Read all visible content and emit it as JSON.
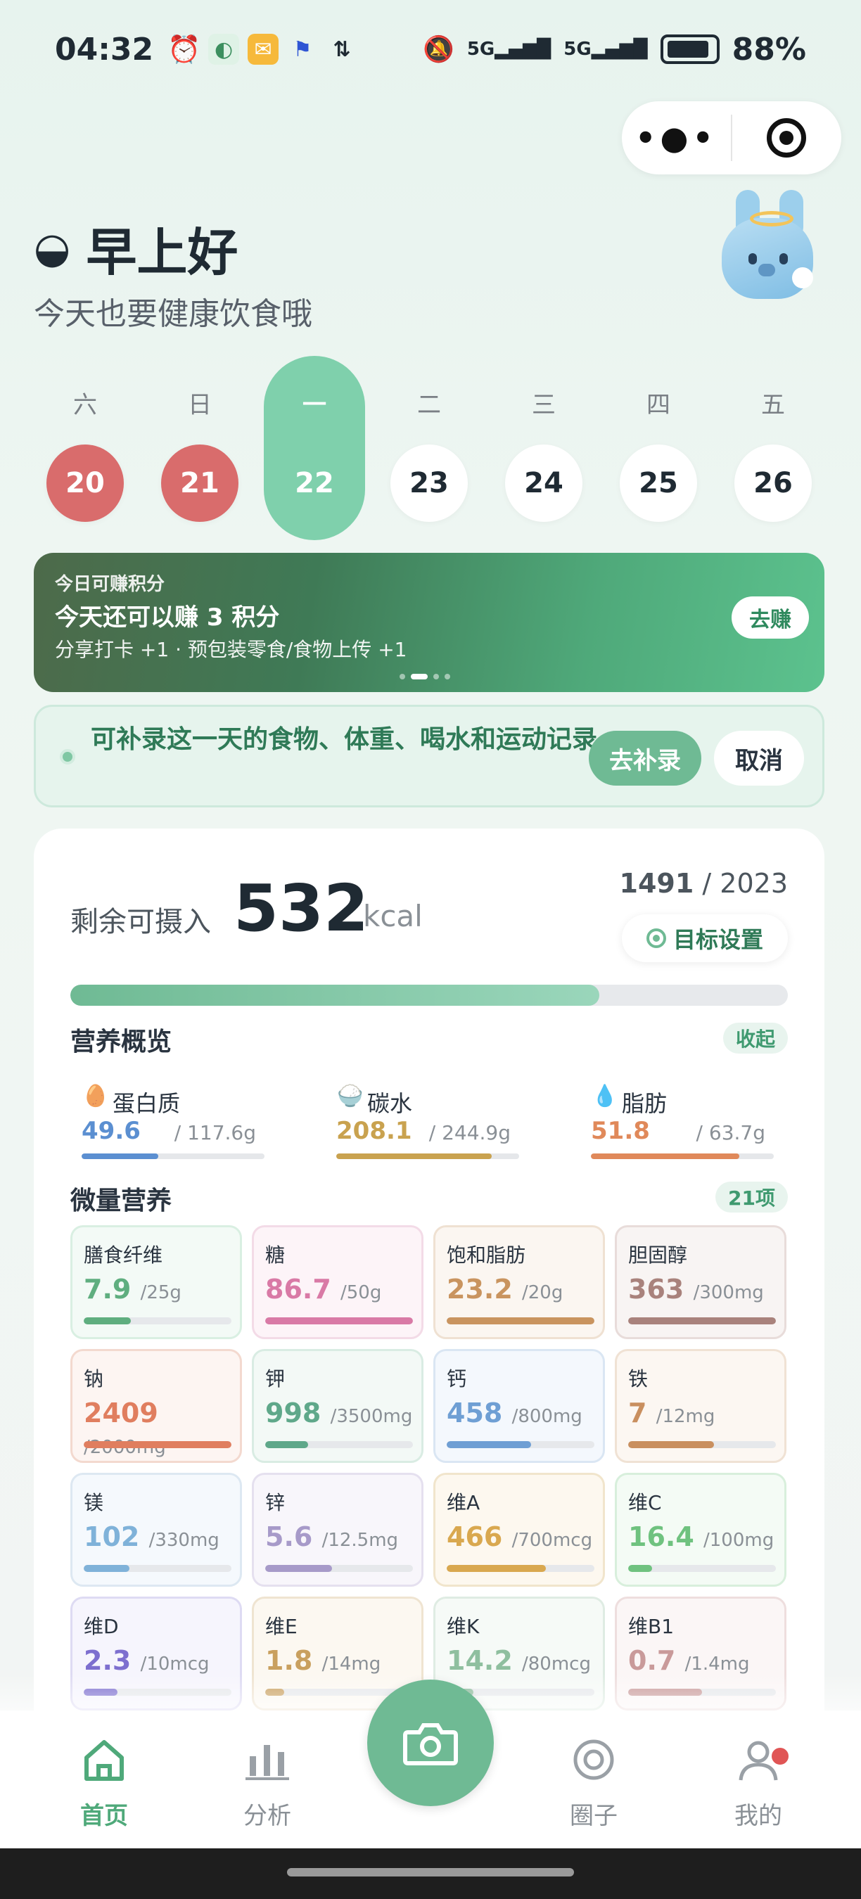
{
  "status": {
    "time": "04:32",
    "battery": "88%",
    "net1": "5G",
    "net2": "5G"
  },
  "greeting": {
    "title": "早上好",
    "subtitle": "今天也要健康饮食哦"
  },
  "week": [
    {
      "wd": "六",
      "num": "20",
      "state": "red"
    },
    {
      "wd": "日",
      "num": "21",
      "state": "red"
    },
    {
      "wd": "一",
      "num": "22",
      "state": "selected"
    },
    {
      "wd": "二",
      "num": "23",
      "state": "normal"
    },
    {
      "wd": "三",
      "num": "24",
      "state": "normal"
    },
    {
      "wd": "四",
      "num": "25",
      "state": "normal"
    },
    {
      "wd": "五",
      "num": "26",
      "state": "normal"
    }
  ],
  "banner": {
    "label": "今日可赚积分",
    "title": "今天还可以赚 3 积分",
    "desc": "分享打卡 +1 · 预包装零食/食物上传 +1",
    "button": "去赚"
  },
  "notice": {
    "text": "可补录这一天的食物、体重、喝水和运动记录",
    "primary": "去补录",
    "secondary": "取消"
  },
  "calories": {
    "label": "剩余可摄入",
    "value": "532",
    "unit": "kcal",
    "eaten": "1491",
    "target": "/ 2023",
    "goal_button": "目标设置",
    "progress": 0.737
  },
  "nutrition": {
    "title": "营养概览",
    "toggle": "收起"
  },
  "macros": [
    {
      "name": "蛋白质",
      "icon": "egg-icon",
      "value": "49.6",
      "total": "/ 117.6g",
      "pct": 0.42,
      "color": "#5b8fd1"
    },
    {
      "name": "碳水",
      "icon": "rice-bowl-icon",
      "value": "208.1",
      "total": "/ 244.9g",
      "pct": 0.85,
      "color": "#c9a24f"
    },
    {
      "name": "脂肪",
      "icon": "oil-drop-icon",
      "value": "51.8",
      "total": "/ 63.7g",
      "pct": 0.81,
      "color": "#e0895a"
    }
  ],
  "micro": {
    "title": "微量营养",
    "count": "21项"
  },
  "micros": [
    {
      "name": "膳食纤维",
      "value": "7.9",
      "total": "/25g",
      "pct": 0.32,
      "color": "#5fae7f",
      "bg": "#f3faf6",
      "border": "#d9efe2"
    },
    {
      "name": "糖",
      "value": "86.7",
      "total": "/50g",
      "pct": 1.0,
      "color": "#d97aa6",
      "bg": "#fdf4f8",
      "border": "#f3dbe7"
    },
    {
      "name": "饱和脂肪",
      "value": "23.2",
      "total": "/20g",
      "pct": 1.0,
      "color": "#c9945f",
      "bg": "#fbf6f1",
      "border": "#efe1d2"
    },
    {
      "name": "胆固醇",
      "value": "363",
      "total": "/300mg",
      "pct": 1.0,
      "color": "#a9827c",
      "bg": "#f8f4f3",
      "border": "#e8dcda"
    },
    {
      "name": "钠",
      "value": "2409",
      "total": "/2000mg",
      "pct": 1.0,
      "color": "#e07e5f",
      "bg": "#fdf5f2",
      "border": "#f3d9cf"
    },
    {
      "name": "钾",
      "value": "998",
      "total": "/3500mg",
      "pct": 0.29,
      "color": "#5fa88a",
      "bg": "#f3f9f6",
      "border": "#d9ece3"
    },
    {
      "name": "钙",
      "value": "458",
      "total": "/800mg",
      "pct": 0.57,
      "color": "#6f9fd4",
      "bg": "#f4f8fd",
      "border": "#dae6f3"
    },
    {
      "name": "铁",
      "value": "7",
      "total": "/12mg",
      "pct": 0.58,
      "color": "#c98f5f",
      "bg": "#fcf7f2",
      "border": "#f0e2d4"
    },
    {
      "name": "镁",
      "value": "102",
      "total": "/330mg",
      "pct": 0.31,
      "color": "#7fb2d9",
      "bg": "#f5f9fd",
      "border": "#dde8f2"
    },
    {
      "name": "锌",
      "value": "5.6",
      "total": "/12.5mg",
      "pct": 0.45,
      "color": "#a79ac9",
      "bg": "#f8f6fb",
      "border": "#e5e0ef"
    },
    {
      "name": "维A",
      "value": "466",
      "total": "/700mcg",
      "pct": 0.67,
      "color": "#d9a84f",
      "bg": "#fdf8ef",
      "border": "#f1e5cc"
    },
    {
      "name": "维C",
      "value": "16.4",
      "total": "/100mg",
      "pct": 0.16,
      "color": "#6fc27f",
      "bg": "#f4fbf5",
      "border": "#d8efdc"
    },
    {
      "name": "维D",
      "value": "2.3",
      "total": "/10mcg",
      "pct": 0.23,
      "color": "#7d6fcf",
      "bg": "#f6f5fd",
      "border": "#dedbf3"
    },
    {
      "name": "维E",
      "value": "1.8",
      "total": "/14mg",
      "pct": 0.13,
      "color": "#c9a05f",
      "bg": "#fcf8f1",
      "border": "#efe4d1"
    },
    {
      "name": "维K",
      "value": "14.2",
      "total": "/80mcg",
      "pct": 0.18,
      "color": "#8fbf9f",
      "bg": "#f6faf7",
      "border": "#dfece3"
    },
    {
      "name": "维B1",
      "value": "0.7",
      "total": "/1.4mg",
      "pct": 0.5,
      "color": "#c99a9a",
      "bg": "#fbf6f6",
      "border": "#eedede"
    }
  ],
  "tabs": [
    {
      "label": "首页",
      "icon": "home-icon",
      "active": true
    },
    {
      "label": "分析",
      "icon": "bar-chart-icon",
      "active": false
    },
    {
      "label": "圈子",
      "icon": "circle-icon",
      "active": false
    },
    {
      "label": "我的",
      "icon": "user-icon",
      "active": false,
      "badge": true
    }
  ],
  "colors": {
    "accent": "#6fba94",
    "red_day": "#d96c6c",
    "selected_day": "#7fd0ac"
  }
}
